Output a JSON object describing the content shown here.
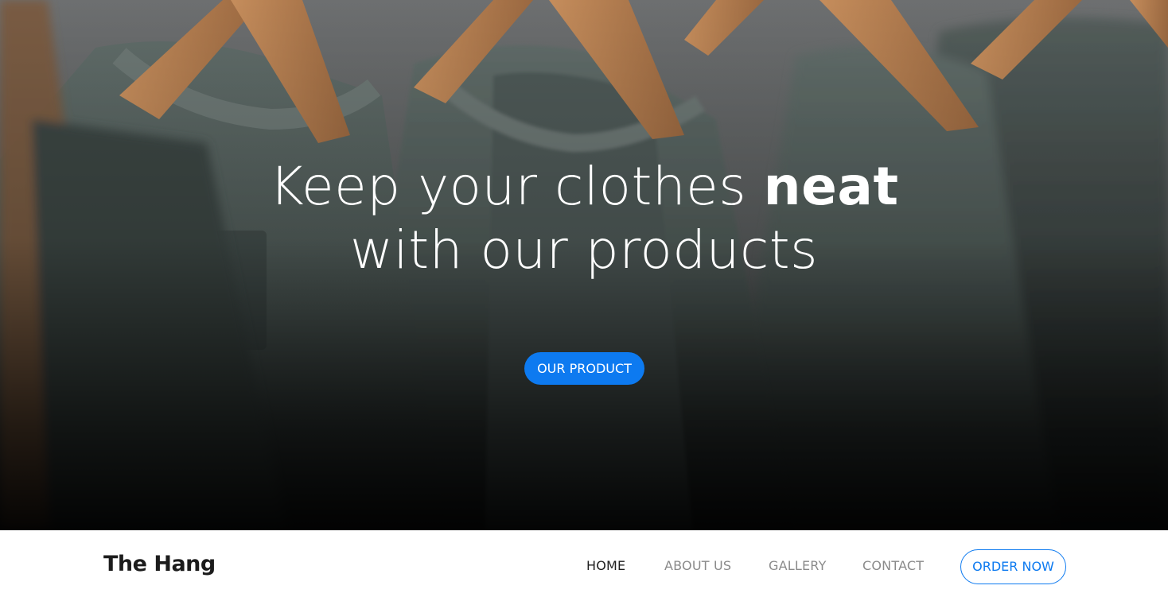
{
  "hero": {
    "headline_part1": "Keep your clothes ",
    "headline_bold": "neat",
    "headline_line2": "with our products",
    "cta_label": "OUR PRODUCT",
    "background": "photo of green t-shirts on wooden hangers"
  },
  "navbar": {
    "brand": "The Hang",
    "links": [
      {
        "label": "HOME",
        "active": true
      },
      {
        "label": "ABOUT US",
        "active": false
      },
      {
        "label": "GALLERY",
        "active": false
      },
      {
        "label": "CONTACT",
        "active": false
      }
    ],
    "order_button": "ORDER NOW"
  },
  "colors": {
    "accent": "#0d7af0",
    "nav_text": "#8a8a8a",
    "nav_active": "#1f1f1f",
    "brand_text": "#1c1c1c",
    "shirt": "#56625f",
    "hanger": "#b07a4c"
  }
}
